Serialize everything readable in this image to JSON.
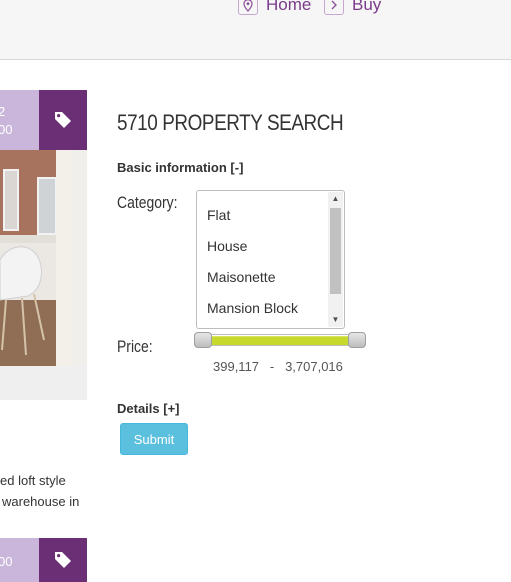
{
  "nav": {
    "home": "Home",
    "buy": "Buy",
    "home_icon": "map-pin-icon",
    "buy_icon": "chevron-right-icon"
  },
  "cards": [
    {
      "price_line1": "2",
      "price_line2": "00",
      "icon": "tag-icon"
    },
    {
      "price_line1": "",
      "price_line2": "00",
      "icon": "tag-icon"
    }
  ],
  "listing": {
    "desc_line1": "ed loft style",
    "desc_line2": "warehouse in"
  },
  "search": {
    "title": "5710 PROPERTY SEARCH",
    "basic_label": "Basic information [-]",
    "category_label": "Category:",
    "category_options": [
      "Flat",
      "House",
      "Maisonette",
      "Mansion Block"
    ],
    "price_label": "Price:",
    "price_min": "399,117",
    "price_separator": "-",
    "price_max": "3,707,016",
    "price_range_fraction": [
      0.03,
      0.97
    ],
    "details_label": "Details [+]",
    "submit_label": "Submit"
  },
  "colors": {
    "brand_purple": "#6b2f75",
    "price_purple_light": "#c9b6da",
    "slider_green": "#c6d92c",
    "submit_blue": "#5bc0de"
  }
}
